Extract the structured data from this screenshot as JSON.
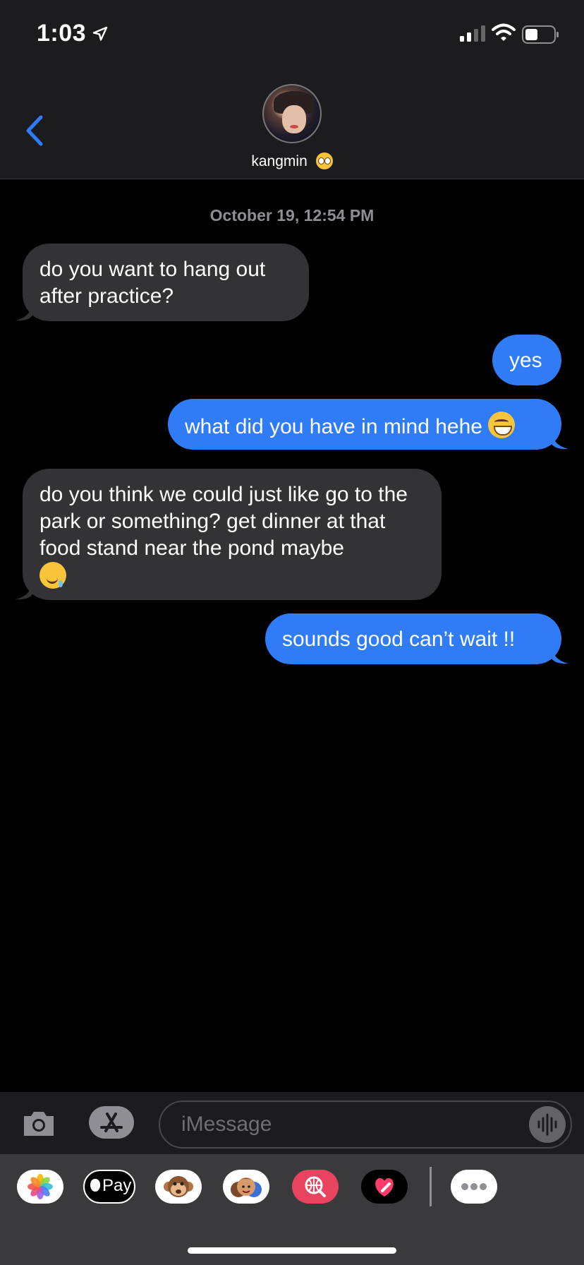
{
  "status": {
    "time": "1:03"
  },
  "contact": {
    "name": "kangmin"
  },
  "thread": {
    "timestamp": "October 19, 12:54 PM",
    "messages": [
      {
        "from": "them",
        "text": "do you want to hang out after practice?"
      },
      {
        "from": "me",
        "text": "yes"
      },
      {
        "from": "me",
        "text": "what did you have in mind hehe",
        "emoji": "grinning-face"
      },
      {
        "from": "them",
        "text": "do you think we could just like go to the park or something? get dinner at that food stand near the pond maybe",
        "emoji": "drooling-face"
      },
      {
        "from": "me",
        "text": "sounds good can’t wait !!"
      }
    ]
  },
  "composer": {
    "placeholder": "iMessage"
  },
  "apps": [
    {
      "name": "Photos",
      "icon": "photos-icon"
    },
    {
      "name": "Apple Pay",
      "label": "Pay",
      "icon": "apple-pay-icon"
    },
    {
      "name": "Animoji",
      "icon": "monkey-icon"
    },
    {
      "name": "Memoji",
      "icon": "memoji-icon"
    },
    {
      "name": "Images",
      "icon": "globe-search-icon"
    },
    {
      "name": "Digital Touch",
      "icon": "heart-icon"
    },
    {
      "name": "More",
      "icon": "more-icon"
    }
  ],
  "colors": {
    "outgoing": "#2f7cf6",
    "incoming": "#333335",
    "accent": "#2f7cf6"
  }
}
